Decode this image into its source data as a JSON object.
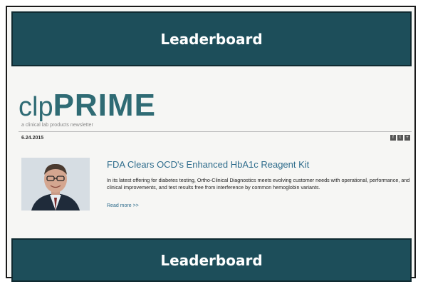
{
  "ads": {
    "top_label": "Leaderboard",
    "bottom_label": "Leaderboard"
  },
  "newsletter": {
    "logo_prefix": "clp",
    "logo_main": "PRIME",
    "tagline": "a clinical lab products newsletter",
    "date": "6.24.2015",
    "social_icons": [
      "facebook-icon",
      "twitter-icon",
      "share-icon"
    ],
    "article": {
      "headline": "FDA Clears OCD's Enhanced HbA1c Reagent Kit",
      "body": "In its latest offering for diabetes testing, Ortho-Clinical Diagnostics meets evolving customer needs with operational, performance, and clinical improvements, and test results free from interference by common hemoglobin variants.",
      "read_more": "Read more >>"
    }
  },
  "colors": {
    "leaderboard_bg": "#1d4e5a",
    "logo": "#2f6b74",
    "headline": "#2e6c8c"
  }
}
